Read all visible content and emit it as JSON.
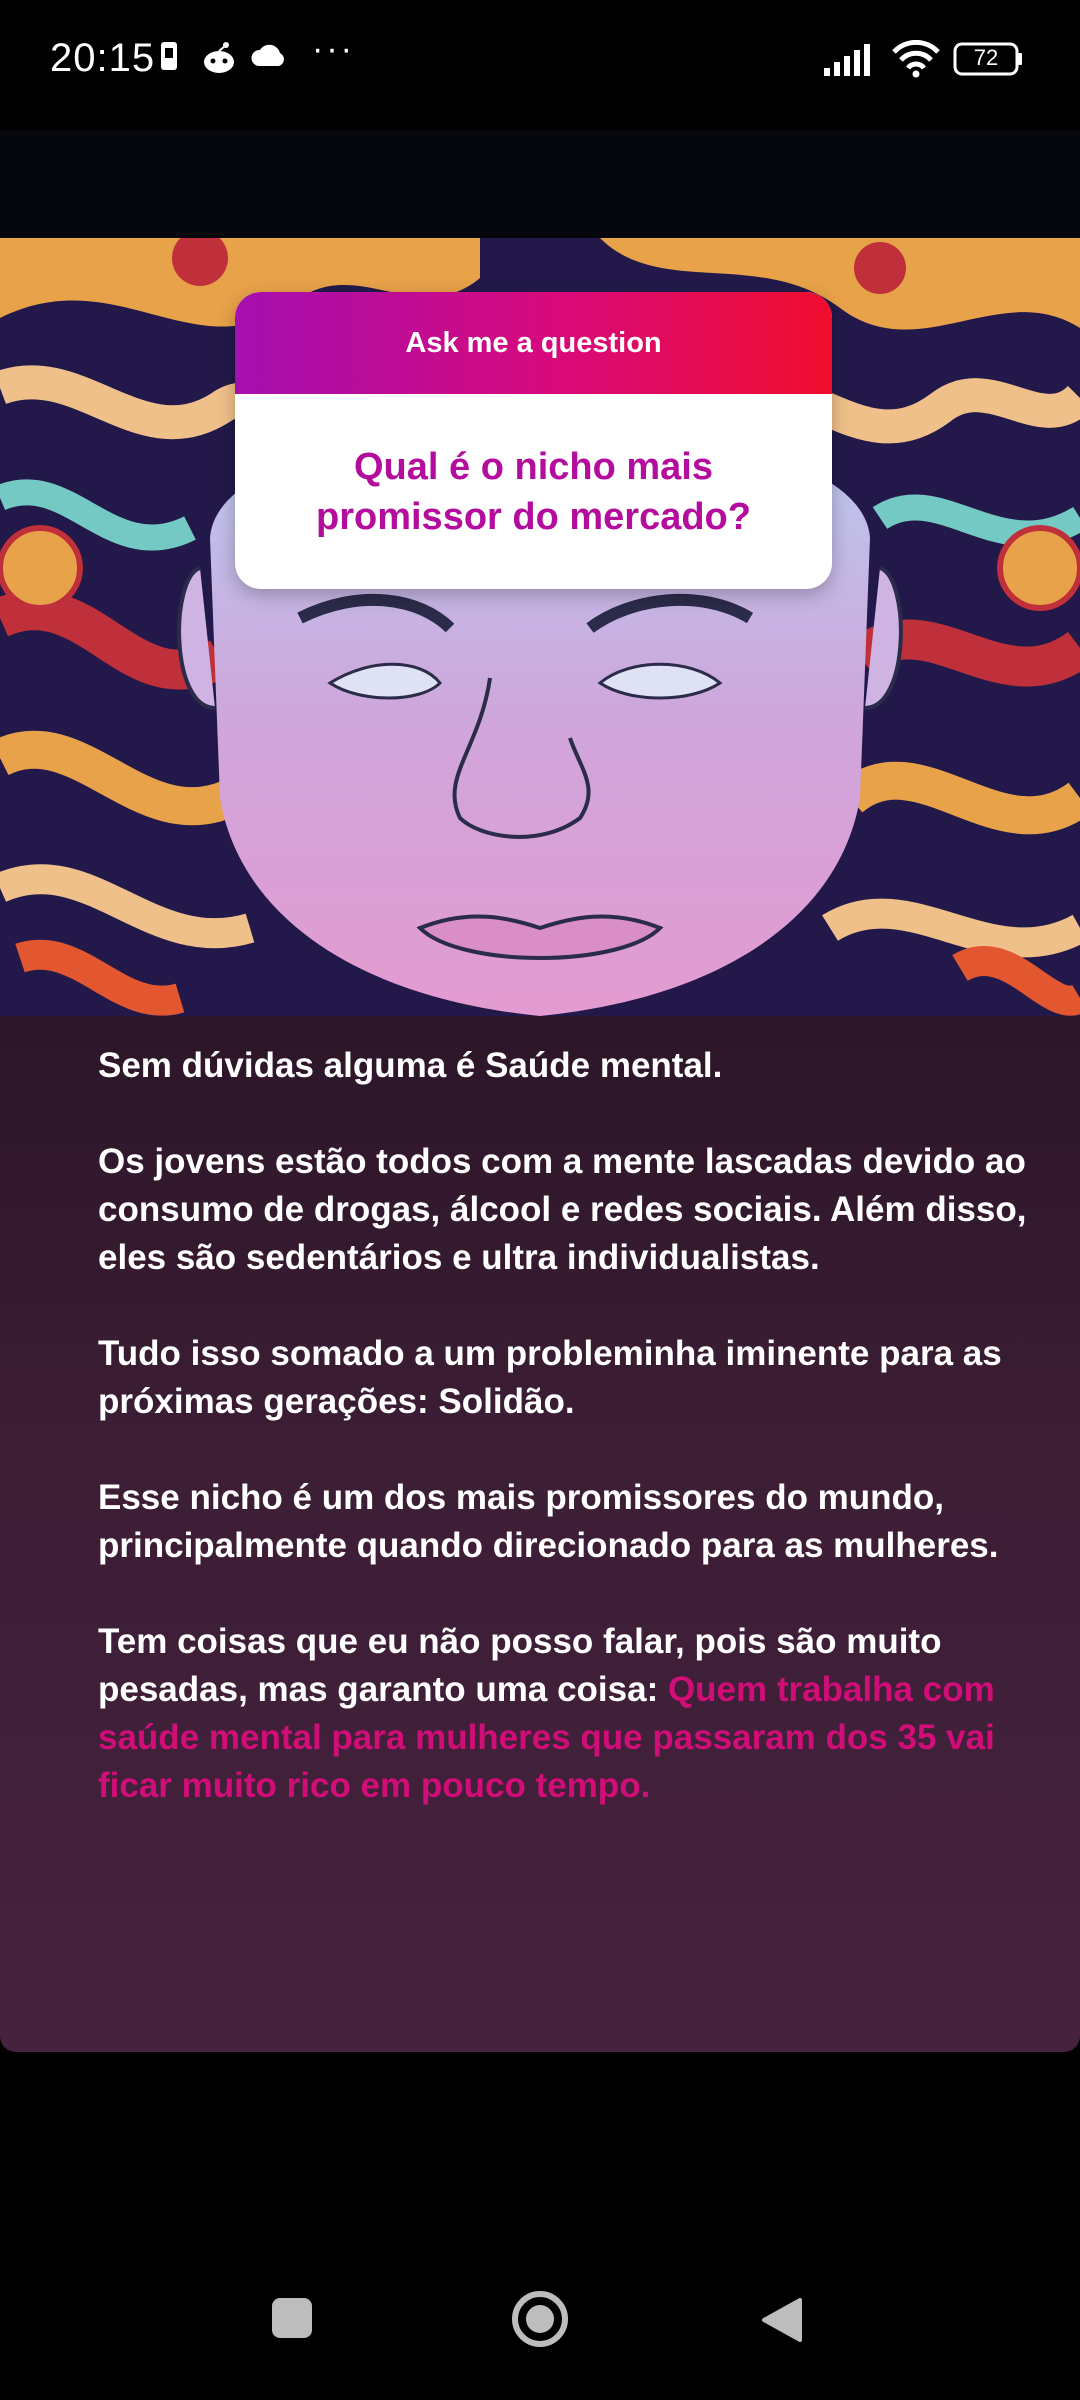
{
  "status_bar": {
    "time": "20:15",
    "more_indicator": "···",
    "battery_level": "72",
    "left_icons": [
      "sim-card-icon",
      "bot-app-icon",
      "cloud-icon"
    ],
    "right_icons": [
      "signal-icon",
      "wifi-icon",
      "battery-icon"
    ]
  },
  "sticker": {
    "header": "Ask me a question",
    "question": "Qual é o nicho mais promissor do mercado?",
    "gradient": [
      "#a50fb0",
      "#d9097a",
      "#ef0d2c"
    ],
    "question_color": "#b40d9e"
  },
  "answer": {
    "p1": "Sem dúvidas alguma é Saúde mental.",
    "p2": "Os jovens estão todos com a mente lascadas devido ao consumo de drogas, álcool e redes sociais. Além disso, eles são sedentários e ultra individualistas.",
    "p3": "Tudo isso somado a um probleminha iminente para as próximas gerações: Solidão.",
    "p4": "Esse nicho é um dos mais promissores do mundo, principalmente quando direcionado para as mulheres.",
    "p5_normal": "Tem coisas que eu não posso falar, pois são muito pesadas, mas garanto uma coisa: ",
    "p5_highlight": "Quem trabalha com saúde mental para mulheres que passaram dos 35 vai ficar muito rico em pouco tempo.",
    "highlight_color": "#d10d77"
  },
  "nav_bar": {
    "buttons": [
      "recents-square-icon",
      "home-circle-icon",
      "back-triangle-icon"
    ]
  }
}
